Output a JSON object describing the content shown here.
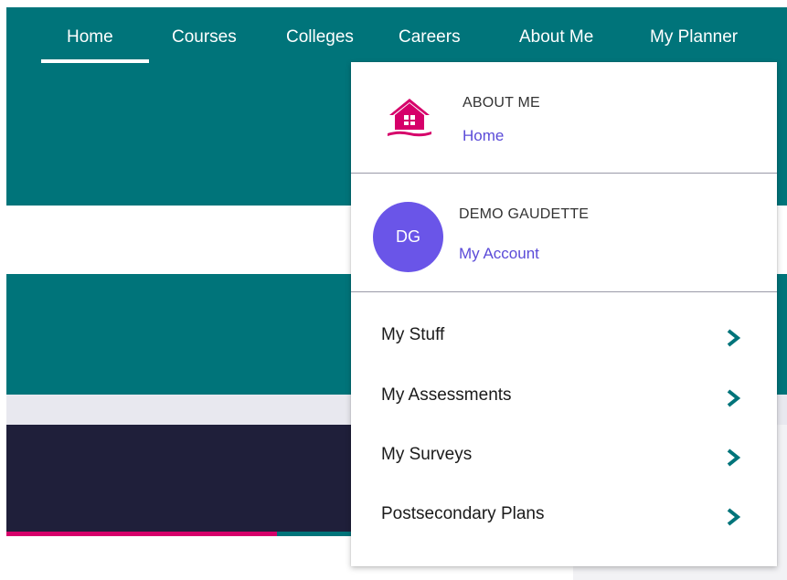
{
  "colors": {
    "teal": "#00747a",
    "navy": "#1f1f3a",
    "pink": "#d6006a",
    "link": "#5b4bd8",
    "avatar_bg": "#6a55e8"
  },
  "topnav": {
    "items": [
      {
        "label": "Home",
        "active": true
      },
      {
        "label": "Courses"
      },
      {
        "label": "Colleges"
      },
      {
        "label": "Careers"
      },
      {
        "label": "About Me"
      },
      {
        "label": "My Planner"
      }
    ]
  },
  "dropdown": {
    "section": {
      "icon": "house-icon",
      "label": "ABOUT ME",
      "link": "Home"
    },
    "account": {
      "initials": "DG",
      "name": "DEMO GAUDETTE",
      "link": "My Account"
    },
    "menu": [
      {
        "label": "My Stuff",
        "icon": "chevron-right-icon"
      },
      {
        "label": "My Assessments",
        "icon": "chevron-right-icon"
      },
      {
        "label": "My Surveys",
        "icon": "chevron-right-icon"
      },
      {
        "label": "Postsecondary Plans",
        "icon": "chevron-right-icon"
      }
    ]
  }
}
